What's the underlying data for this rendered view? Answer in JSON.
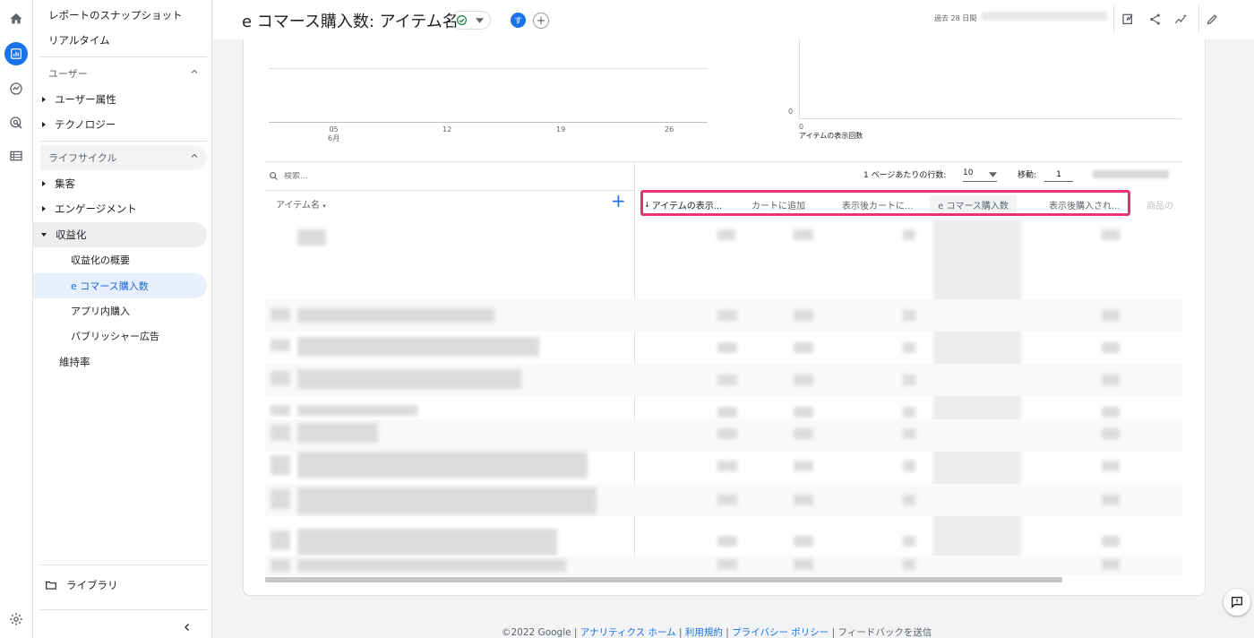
{
  "colors": {
    "accent": "#1a73e8",
    "highlight": "#e8336d",
    "check": "#188038"
  },
  "rail": [
    {
      "name": "home",
      "icon": "home-icon"
    },
    {
      "name": "reports",
      "icon": "bar-chart-icon",
      "active": true
    },
    {
      "name": "explore",
      "icon": "explore-icon"
    },
    {
      "name": "advertising",
      "icon": "target-cursor-icon"
    },
    {
      "name": "configure",
      "icon": "list-icon"
    }
  ],
  "nav": {
    "snapshot": "レポートのスナップショット",
    "realtime": "リアルタイム",
    "section_user": "ユーザー",
    "user_attributes": "ユーザー属性",
    "technology": "テクノロジー",
    "section_lifecycle": "ライフサイクル",
    "acquisition": "集客",
    "engagement": "エンゲージメント",
    "monetization": "収益化",
    "monetization_overview": "収益化の概要",
    "ecommerce_purchases": "e コマース購入数",
    "in_app_purchases": "アプリ内購入",
    "publisher_ads": "パブリッシャー広告",
    "retention": "維持率",
    "library": "ライブラリ"
  },
  "header": {
    "title": "e コマース購入数: アイテム名",
    "avatar_letter": "す",
    "add_comparison": "+",
    "date_range_label": "過去 28 日間"
  },
  "chart": {
    "ticks": [
      "05",
      "12",
      "19",
      "26"
    ],
    "month": "6月",
    "right_y_zero": "0",
    "right_x_zero": "0",
    "right_xlabel": "アイテムの表示回数"
  },
  "table": {
    "search_placeholder": "検索...",
    "rows_per_page_label": "1 ページあたりの行数:",
    "rows_per_page": "10",
    "goto_label": "移動:",
    "goto_value": "1",
    "dimension_header": "アイテム名",
    "add_dimension": "+",
    "metric_headers": [
      "アイテムの表示...",
      "カートに追加",
      "表示後カートに...",
      "e コマース購入数",
      "表示後購入され...",
      "商品の"
    ]
  },
  "footer": {
    "copyright": "©2022 Google |",
    "analytics_home": "アナリティクス ホーム",
    "sep1": "|",
    "terms": "利用規約",
    "sep2": "|",
    "privacy": "プライバシー ポリシー",
    "sep3": "|",
    "feedback": "フィードバックを送信"
  }
}
